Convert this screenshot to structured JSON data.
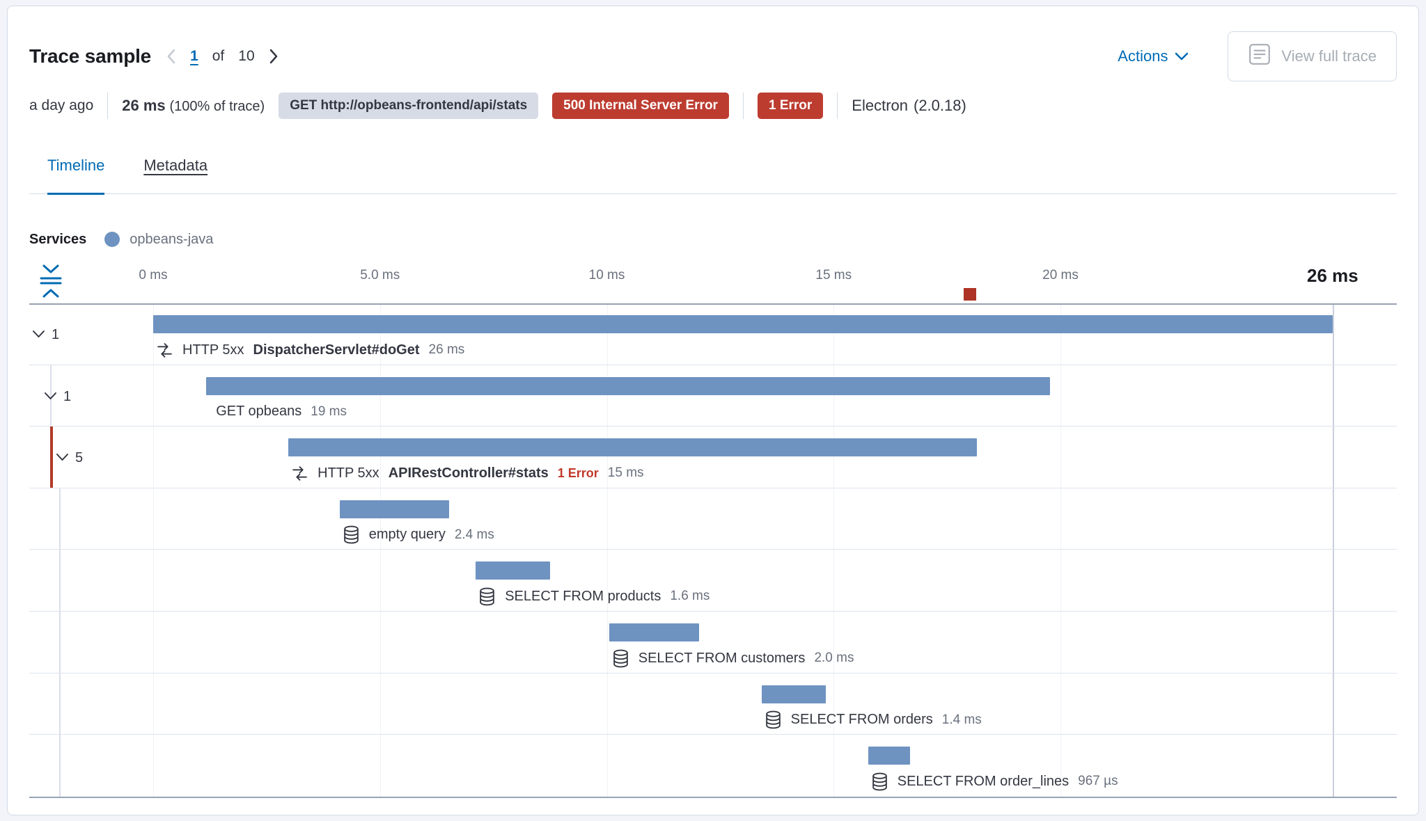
{
  "header": {
    "title": "Trace sample",
    "pagination": {
      "current": "1",
      "of_label": "of",
      "total": "10"
    },
    "actions_label": "Actions",
    "view_full_trace_label": "View full trace"
  },
  "summary": {
    "time_ago": "a day ago",
    "duration": "26 ms",
    "duration_pct": "(100% of trace)",
    "url_badge": "GET http://opbeans-frontend/api/stats",
    "status_badge": "500 Internal Server Error",
    "error_badge": "1 Error",
    "agent": "Electron",
    "agent_version": "(2.0.18)"
  },
  "tabs": [
    {
      "label": "Timeline",
      "active": true
    },
    {
      "label": "Metadata",
      "active": false
    }
  ],
  "legend": {
    "label": "Services",
    "service": "opbeans-java",
    "color": "#6e93c1"
  },
  "chart_data": {
    "type": "waterfall",
    "unit": "ms",
    "total_ms": 26,
    "total_label": "26 ms",
    "axis_ticks": [
      {
        "label": "0 ms",
        "ms": 0
      },
      {
        "label": "5.0 ms",
        "ms": 5
      },
      {
        "label": "10 ms",
        "ms": 10
      },
      {
        "label": "15 ms",
        "ms": 15
      },
      {
        "label": "20 ms",
        "ms": 20
      }
    ],
    "error_marker_ms": 18,
    "bar_color": "#6e93c1",
    "error_color": "#ad3326",
    "rows": [
      {
        "kind": "transaction",
        "icon": "merge-icon",
        "toggle_count": "1",
        "indent": 0,
        "prefix": "HTTP 5xx",
        "name": "DispatcherServlet#doGet",
        "bold": true,
        "duration_label": "26 ms",
        "start_ms": 0,
        "width_ms": 26
      },
      {
        "kind": "transaction",
        "icon": null,
        "toggle_count": "1",
        "indent": 1,
        "prefix": null,
        "name": "GET opbeans",
        "bold": false,
        "duration_label": "19 ms",
        "start_ms": 1.17,
        "width_ms": 18.6
      },
      {
        "kind": "transaction",
        "icon": "merge-icon",
        "toggle_count": "5",
        "indent": 2,
        "prefix": "HTTP 5xx",
        "name": "APIRestController#stats",
        "bold": true,
        "error_label": "1 Error",
        "error_accent": true,
        "duration_label": "15 ms",
        "start_ms": 2.98,
        "width_ms": 15.18
      },
      {
        "kind": "span",
        "icon": "database-icon",
        "indent": 3,
        "name": "empty query",
        "bold": false,
        "duration_label": "2.4 ms",
        "start_ms": 4.11,
        "width_ms": 2.41
      },
      {
        "kind": "span",
        "icon": "database-icon",
        "indent": 3,
        "name": "SELECT FROM products",
        "bold": false,
        "duration_label": "1.6 ms",
        "start_ms": 7.11,
        "width_ms": 1.64
      },
      {
        "kind": "span",
        "icon": "database-icon",
        "indent": 3,
        "name": "SELECT FROM customers",
        "bold": false,
        "duration_label": "2.0 ms",
        "start_ms": 10.05,
        "width_ms": 1.98
      },
      {
        "kind": "span",
        "icon": "database-icon",
        "indent": 3,
        "name": "SELECT FROM orders",
        "bold": false,
        "duration_label": "1.4 ms",
        "start_ms": 13.41,
        "width_ms": 1.41
      },
      {
        "kind": "span",
        "icon": "database-icon",
        "indent": 3,
        "name": "SELECT FROM order_lines",
        "bold": false,
        "duration_label": "967 µs",
        "start_ms": 15.76,
        "width_ms": 0.92
      }
    ]
  }
}
